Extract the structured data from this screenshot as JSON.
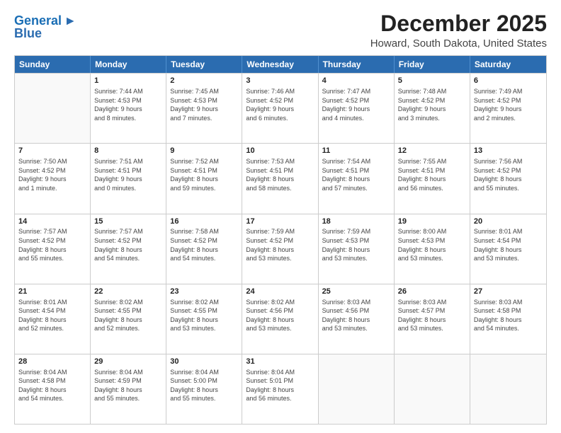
{
  "logo": {
    "line1": "General",
    "line2": "Blue"
  },
  "title": "December 2025",
  "location": "Howard, South Dakota, United States",
  "header": {
    "days": [
      "Sunday",
      "Monday",
      "Tuesday",
      "Wednesday",
      "Thursday",
      "Friday",
      "Saturday"
    ]
  },
  "weeks": [
    [
      {
        "day": "",
        "info": ""
      },
      {
        "day": "1",
        "info": "Sunrise: 7:44 AM\nSunset: 4:53 PM\nDaylight: 9 hours\nand 8 minutes."
      },
      {
        "day": "2",
        "info": "Sunrise: 7:45 AM\nSunset: 4:53 PM\nDaylight: 9 hours\nand 7 minutes."
      },
      {
        "day": "3",
        "info": "Sunrise: 7:46 AM\nSunset: 4:52 PM\nDaylight: 9 hours\nand 6 minutes."
      },
      {
        "day": "4",
        "info": "Sunrise: 7:47 AM\nSunset: 4:52 PM\nDaylight: 9 hours\nand 4 minutes."
      },
      {
        "day": "5",
        "info": "Sunrise: 7:48 AM\nSunset: 4:52 PM\nDaylight: 9 hours\nand 3 minutes."
      },
      {
        "day": "6",
        "info": "Sunrise: 7:49 AM\nSunset: 4:52 PM\nDaylight: 9 hours\nand 2 minutes."
      }
    ],
    [
      {
        "day": "7",
        "info": "Sunrise: 7:50 AM\nSunset: 4:52 PM\nDaylight: 9 hours\nand 1 minute."
      },
      {
        "day": "8",
        "info": "Sunrise: 7:51 AM\nSunset: 4:51 PM\nDaylight: 9 hours\nand 0 minutes."
      },
      {
        "day": "9",
        "info": "Sunrise: 7:52 AM\nSunset: 4:51 PM\nDaylight: 8 hours\nand 59 minutes."
      },
      {
        "day": "10",
        "info": "Sunrise: 7:53 AM\nSunset: 4:51 PM\nDaylight: 8 hours\nand 58 minutes."
      },
      {
        "day": "11",
        "info": "Sunrise: 7:54 AM\nSunset: 4:51 PM\nDaylight: 8 hours\nand 57 minutes."
      },
      {
        "day": "12",
        "info": "Sunrise: 7:55 AM\nSunset: 4:51 PM\nDaylight: 8 hours\nand 56 minutes."
      },
      {
        "day": "13",
        "info": "Sunrise: 7:56 AM\nSunset: 4:52 PM\nDaylight: 8 hours\nand 55 minutes."
      }
    ],
    [
      {
        "day": "14",
        "info": "Sunrise: 7:57 AM\nSunset: 4:52 PM\nDaylight: 8 hours\nand 55 minutes."
      },
      {
        "day": "15",
        "info": "Sunrise: 7:57 AM\nSunset: 4:52 PM\nDaylight: 8 hours\nand 54 minutes."
      },
      {
        "day": "16",
        "info": "Sunrise: 7:58 AM\nSunset: 4:52 PM\nDaylight: 8 hours\nand 54 minutes."
      },
      {
        "day": "17",
        "info": "Sunrise: 7:59 AM\nSunset: 4:52 PM\nDaylight: 8 hours\nand 53 minutes."
      },
      {
        "day": "18",
        "info": "Sunrise: 7:59 AM\nSunset: 4:53 PM\nDaylight: 8 hours\nand 53 minutes."
      },
      {
        "day": "19",
        "info": "Sunrise: 8:00 AM\nSunset: 4:53 PM\nDaylight: 8 hours\nand 53 minutes."
      },
      {
        "day": "20",
        "info": "Sunrise: 8:01 AM\nSunset: 4:54 PM\nDaylight: 8 hours\nand 53 minutes."
      }
    ],
    [
      {
        "day": "21",
        "info": "Sunrise: 8:01 AM\nSunset: 4:54 PM\nDaylight: 8 hours\nand 52 minutes."
      },
      {
        "day": "22",
        "info": "Sunrise: 8:02 AM\nSunset: 4:55 PM\nDaylight: 8 hours\nand 52 minutes."
      },
      {
        "day": "23",
        "info": "Sunrise: 8:02 AM\nSunset: 4:55 PM\nDaylight: 8 hours\nand 53 minutes."
      },
      {
        "day": "24",
        "info": "Sunrise: 8:02 AM\nSunset: 4:56 PM\nDaylight: 8 hours\nand 53 minutes."
      },
      {
        "day": "25",
        "info": "Sunrise: 8:03 AM\nSunset: 4:56 PM\nDaylight: 8 hours\nand 53 minutes."
      },
      {
        "day": "26",
        "info": "Sunrise: 8:03 AM\nSunset: 4:57 PM\nDaylight: 8 hours\nand 53 minutes."
      },
      {
        "day": "27",
        "info": "Sunrise: 8:03 AM\nSunset: 4:58 PM\nDaylight: 8 hours\nand 54 minutes."
      }
    ],
    [
      {
        "day": "28",
        "info": "Sunrise: 8:04 AM\nSunset: 4:58 PM\nDaylight: 8 hours\nand 54 minutes."
      },
      {
        "day": "29",
        "info": "Sunrise: 8:04 AM\nSunset: 4:59 PM\nDaylight: 8 hours\nand 55 minutes."
      },
      {
        "day": "30",
        "info": "Sunrise: 8:04 AM\nSunset: 5:00 PM\nDaylight: 8 hours\nand 55 minutes."
      },
      {
        "day": "31",
        "info": "Sunrise: 8:04 AM\nSunset: 5:01 PM\nDaylight: 8 hours\nand 56 minutes."
      },
      {
        "day": "",
        "info": ""
      },
      {
        "day": "",
        "info": ""
      },
      {
        "day": "",
        "info": ""
      }
    ]
  ]
}
